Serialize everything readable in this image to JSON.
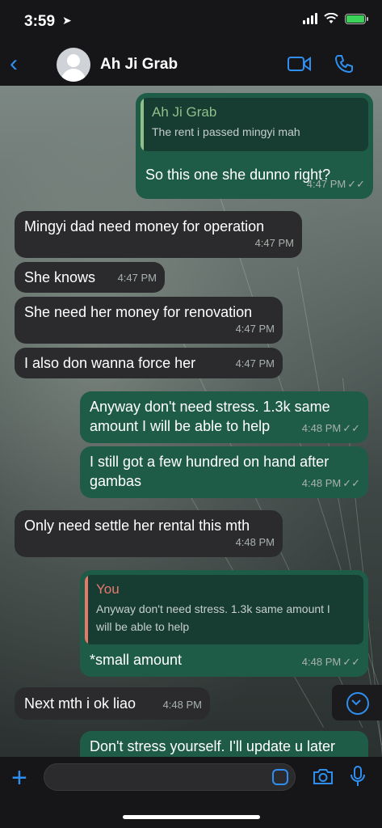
{
  "status_bar": {
    "time": "3:59"
  },
  "header": {
    "contact_name": "Ah Ji Grab"
  },
  "messages": [
    {
      "dir": "out",
      "reply_to": {
        "name": "Ah Ji Grab",
        "text": "The rent i passed mingyi mah"
      },
      "text": "So this one she dunno right?",
      "time": "4:47 PM"
    },
    {
      "dir": "in",
      "text": "Mingyi dad need money for operation",
      "time": "4:47 PM"
    },
    {
      "dir": "in",
      "text": "She knows",
      "time": "4:47 PM"
    },
    {
      "dir": "in",
      "text": "She need her money for renovation",
      "time": "4:47 PM"
    },
    {
      "dir": "in",
      "text": "I also don wanna force her",
      "time": "4:47 PM"
    },
    {
      "dir": "out",
      "text_line1": "Anyway don't need stress. 1.3k same",
      "text_line2": "amount I will be able to help",
      "time": "4:48 PM"
    },
    {
      "dir": "out",
      "text_line1": "I still got a few hundred on hand after",
      "text_line2": "gambas",
      "time": "4:48 PM"
    },
    {
      "dir": "in",
      "text": "Only need settle her rental this mth",
      "time": "4:48 PM"
    },
    {
      "dir": "out",
      "reply_to": {
        "name": "You",
        "text_line1": "Anyway don't need stress. 1.3k same amount I",
        "text_line2": "will be able to help"
      },
      "text": "*small amount",
      "time": "4:48 PM"
    },
    {
      "dir": "in",
      "text": "Next mth i ok liao",
      "time": "4:48 PM"
    },
    {
      "dir": "out",
      "text": "Don't stress yourself. I'll update u later"
    }
  ],
  "icons": [
    "location-arrow-icon",
    "signal-icon",
    "wifi-icon",
    "battery-icon",
    "back-chevron-icon",
    "video-call-icon",
    "phone-icon",
    "scroll-down-icon",
    "plus-icon",
    "sticker-icon",
    "camera-icon",
    "microphone-icon"
  ],
  "colors": {
    "accent": "#2f8ff0",
    "outgoing_bubble": "#1f5c48",
    "incoming_bubble": "#2b2b2d",
    "reply_name_in": "#8fbf8a",
    "reply_name_you": "#e8786c"
  }
}
